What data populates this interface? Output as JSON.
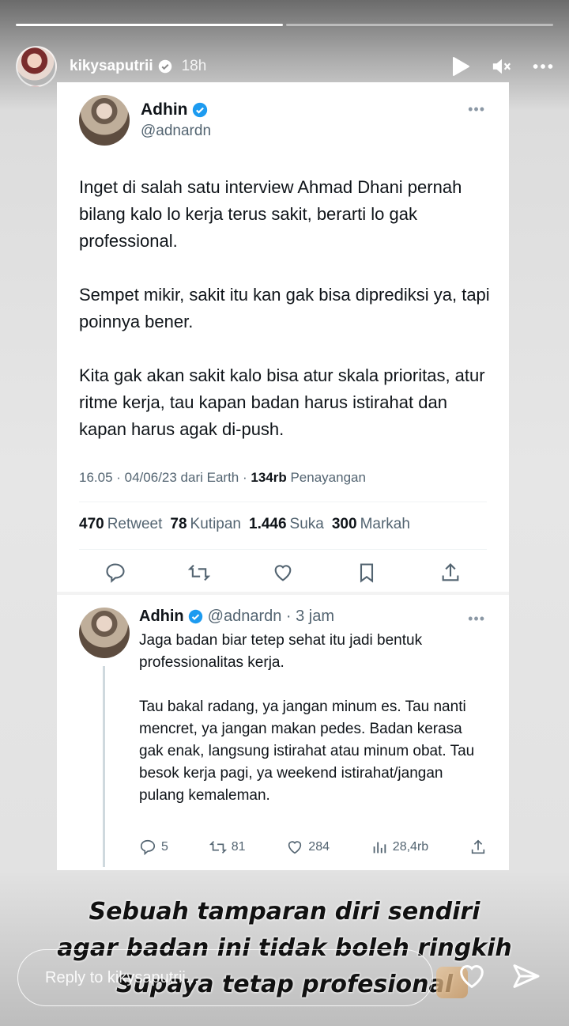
{
  "story": {
    "username": "kikysaputrii",
    "time": "18h",
    "progress_segments": 2,
    "progress_done": 1,
    "caption_lines": [
      "Sebuah tamparan diri sendiri",
      "agar badan ini tidak boleh ringkih",
      "Supaya tetap profesional"
    ],
    "reply_placeholder": "Reply to kikysaputrii...",
    "icons": [
      "play-icon",
      "mute-icon",
      "more-icon",
      "heart-icon",
      "send-icon"
    ]
  },
  "tweet": {
    "name": "Adhin",
    "handle": "@adnardn",
    "paragraphs": [
      "Inget di salah satu interview Ahmad Dhani pernah bilang kalo lo kerja terus sakit, berarti lo gak professional.",
      "Sempet mikir, sakit itu kan gak bisa diprediksi ya, tapi poinnya bener.",
      "Kita gak akan sakit kalo bisa atur skala prioritas, atur ritme kerja, tau kapan badan harus istirahat dan kapan harus agak di-push."
    ],
    "meta_prefix": "16.05 · 04/06/23 dari Earth · ",
    "views_count": "134rb",
    "views_label": " Penayangan",
    "stats": [
      {
        "count": "470",
        "label": "Retweet"
      },
      {
        "count": "78",
        "label": "Kutipan"
      },
      {
        "count": "1.446",
        "label": "Suka"
      },
      {
        "count": "300",
        "label": "Markah"
      }
    ]
  },
  "reply": {
    "name": "Adhin",
    "handle_time": "@adnardn · 3 jam",
    "paragraphs": [
      "Jaga badan biar tetep sehat itu jadi  bentuk professionalitas kerja.",
      "Tau bakal radang, ya jangan minum es. Tau nanti mencret, ya jangan makan pedes. Badan kerasa gak enak, langsung istirahat atau minum obat. Tau besok kerja pagi, ya weekend istirahat/jangan pulang kemaleman."
    ],
    "replies": "5",
    "retweets": "81",
    "likes": "284",
    "views": "28,4rb"
  },
  "colors": {
    "verified": "#1d9bf0",
    "text": "#0f1419",
    "muted": "#536471"
  }
}
